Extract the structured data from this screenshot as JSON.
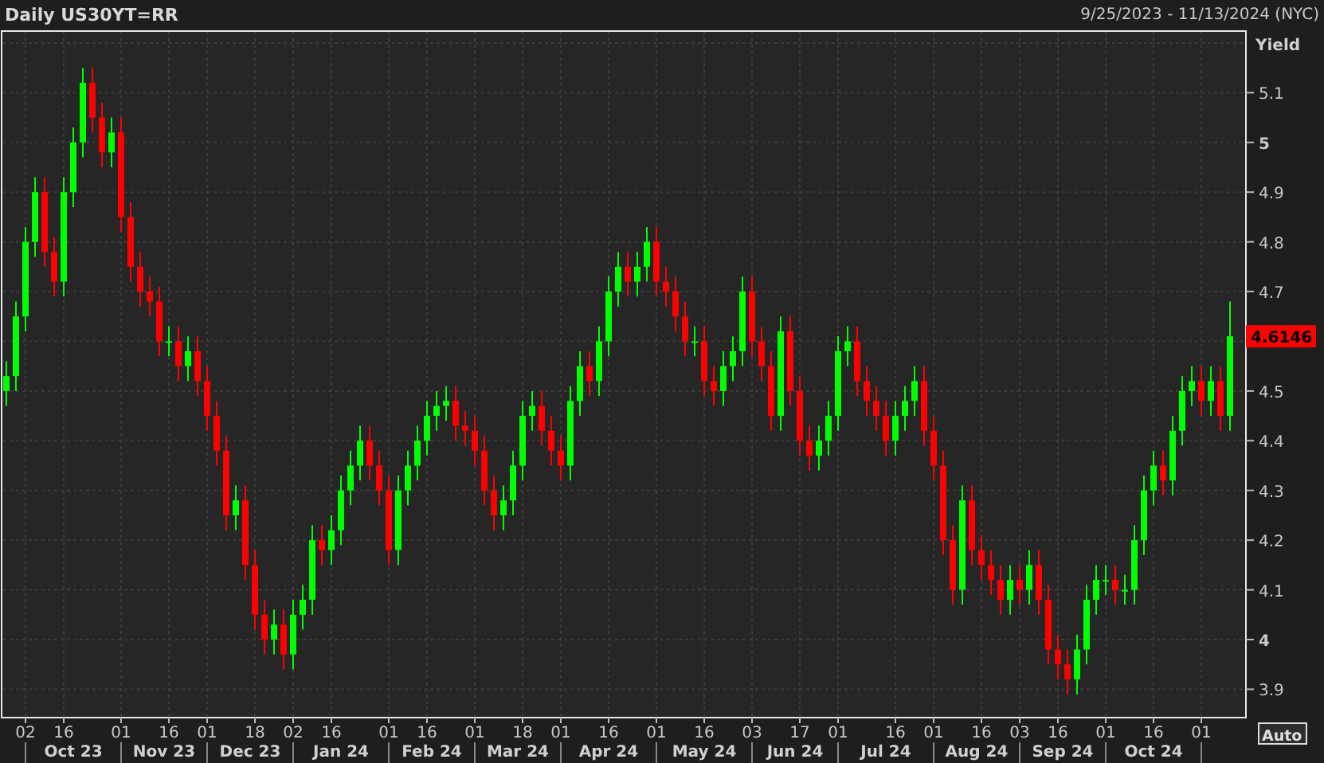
{
  "header": {
    "title": "Daily US30YT=RR",
    "range": "9/25/2023 - 11/13/2024 (NYC)"
  },
  "chart": {
    "chart_data": {
      "type": "candlestick",
      "ylabel": "Yield",
      "ylim": [
        3.843,
        5.224
      ],
      "grid": true,
      "yticks": [
        3.9,
        4,
        4.1,
        4.2,
        4.3,
        4.4,
        4.5,
        4.7,
        4.8,
        4.9,
        5,
        5.1
      ],
      "categories": [
        null,
        null,
        "02",
        null,
        null,
        null,
        "16",
        null,
        null,
        null,
        null,
        null,
        "01",
        null,
        null,
        null,
        null,
        "16",
        null,
        null,
        null,
        "01",
        null,
        null,
        null,
        null,
        "18",
        null,
        null,
        null,
        "02",
        null,
        null,
        null,
        "16",
        null,
        null,
        null,
        null,
        null,
        "01",
        null,
        null,
        null,
        "16",
        null,
        null,
        null,
        null,
        "01",
        null,
        null,
        null,
        null,
        "18",
        null,
        null,
        null,
        "01",
        null,
        null,
        null,
        null,
        "16",
        null,
        null,
        null,
        null,
        "01",
        null,
        null,
        null,
        null,
        "16",
        null,
        null,
        null,
        null,
        "03",
        null,
        null,
        null,
        null,
        "17",
        null,
        null,
        null,
        "01",
        null,
        null,
        null,
        null,
        null,
        "16",
        null,
        null,
        null,
        "01",
        null,
        null,
        null,
        null,
        "16",
        null,
        null,
        null,
        "03",
        null,
        null,
        null,
        "16",
        null,
        null,
        null,
        null,
        "01",
        null,
        null,
        null,
        null,
        "16",
        null,
        null,
        null,
        null,
        "01",
        null,
        null,
        null
      ],
      "ohlc": [
        [
          4.5,
          4.56,
          4.47,
          4.53
        ],
        [
          4.53,
          4.68,
          4.5,
          4.65
        ],
        [
          4.65,
          4.83,
          4.62,
          4.8
        ],
        [
          4.8,
          4.93,
          4.77,
          4.9
        ],
        [
          4.9,
          4.93,
          4.75,
          4.78
        ],
        [
          4.78,
          4.81,
          4.69,
          4.72
        ],
        [
          4.72,
          4.93,
          4.69,
          4.9
        ],
        [
          4.9,
          5.03,
          4.87,
          5.0
        ],
        [
          5.0,
          5.15,
          4.97,
          5.12
        ],
        [
          5.12,
          5.15,
          5.02,
          5.05
        ],
        [
          5.05,
          5.08,
          4.95,
          4.98
        ],
        [
          4.98,
          5.05,
          4.95,
          5.02
        ],
        [
          5.02,
          5.05,
          4.82,
          4.85
        ],
        [
          4.85,
          4.88,
          4.72,
          4.75
        ],
        [
          4.75,
          4.78,
          4.67,
          4.7
        ],
        [
          4.7,
          4.73,
          4.65,
          4.68
        ],
        [
          4.68,
          4.71,
          4.57,
          4.6
        ],
        [
          4.6,
          4.63,
          4.57,
          4.6
        ],
        [
          4.6,
          4.63,
          4.52,
          4.55
        ],
        [
          4.55,
          4.61,
          4.52,
          4.58
        ],
        [
          4.58,
          4.61,
          4.49,
          4.52
        ],
        [
          4.52,
          4.55,
          4.42,
          4.45
        ],
        [
          4.45,
          4.48,
          4.35,
          4.38
        ],
        [
          4.38,
          4.41,
          4.22,
          4.25
        ],
        [
          4.25,
          4.31,
          4.22,
          4.28
        ],
        [
          4.28,
          4.31,
          4.12,
          4.15
        ],
        [
          4.15,
          4.18,
          4.02,
          4.05
        ],
        [
          4.05,
          4.08,
          3.97,
          4.0
        ],
        [
          4.0,
          4.06,
          3.97,
          4.03
        ],
        [
          4.03,
          4.06,
          3.94,
          3.97
        ],
        [
          3.97,
          4.08,
          3.94,
          4.05
        ],
        [
          4.05,
          4.11,
          4.02,
          4.08
        ],
        [
          4.08,
          4.23,
          4.05,
          4.2
        ],
        [
          4.2,
          4.23,
          4.15,
          4.18
        ],
        [
          4.18,
          4.25,
          4.15,
          4.22
        ],
        [
          4.22,
          4.33,
          4.19,
          4.3
        ],
        [
          4.3,
          4.38,
          4.27,
          4.35
        ],
        [
          4.35,
          4.43,
          4.32,
          4.4
        ],
        [
          4.4,
          4.43,
          4.32,
          4.35
        ],
        [
          4.35,
          4.38,
          4.27,
          4.3
        ],
        [
          4.3,
          4.33,
          4.15,
          4.18
        ],
        [
          4.18,
          4.33,
          4.15,
          4.3
        ],
        [
          4.3,
          4.38,
          4.27,
          4.35
        ],
        [
          4.35,
          4.43,
          4.32,
          4.4
        ],
        [
          4.4,
          4.48,
          4.37,
          4.45
        ],
        [
          4.45,
          4.5,
          4.42,
          4.47
        ],
        [
          4.47,
          4.51,
          4.44,
          4.48
        ],
        [
          4.48,
          4.51,
          4.4,
          4.43
        ],
        [
          4.43,
          4.46,
          4.39,
          4.42
        ],
        [
          4.42,
          4.45,
          4.35,
          4.38
        ],
        [
          4.38,
          4.41,
          4.27,
          4.3
        ],
        [
          4.3,
          4.33,
          4.22,
          4.25
        ],
        [
          4.25,
          4.31,
          4.22,
          4.28
        ],
        [
          4.28,
          4.38,
          4.25,
          4.35
        ],
        [
          4.35,
          4.48,
          4.32,
          4.45
        ],
        [
          4.45,
          4.5,
          4.42,
          4.47
        ],
        [
          4.47,
          4.5,
          4.39,
          4.42
        ],
        [
          4.42,
          4.45,
          4.35,
          4.38
        ],
        [
          4.38,
          4.41,
          4.32,
          4.35
        ],
        [
          4.35,
          4.51,
          4.32,
          4.48
        ],
        [
          4.48,
          4.58,
          4.45,
          4.55
        ],
        [
          4.55,
          4.58,
          4.49,
          4.52
        ],
        [
          4.52,
          4.63,
          4.49,
          4.6
        ],
        [
          4.6,
          4.73,
          4.57,
          4.7
        ],
        [
          4.7,
          4.78,
          4.67,
          4.75
        ],
        [
          4.75,
          4.78,
          4.69,
          4.72
        ],
        [
          4.72,
          4.78,
          4.69,
          4.75
        ],
        [
          4.75,
          4.83,
          4.72,
          4.8
        ],
        [
          4.8,
          4.83,
          4.69,
          4.72
        ],
        [
          4.72,
          4.75,
          4.67,
          4.7
        ],
        [
          4.7,
          4.73,
          4.62,
          4.65
        ],
        [
          4.65,
          4.68,
          4.57,
          4.6
        ],
        [
          4.6,
          4.63,
          4.57,
          4.6
        ],
        [
          4.6,
          4.63,
          4.49,
          4.52
        ],
        [
          4.52,
          4.55,
          4.47,
          4.5
        ],
        [
          4.5,
          4.58,
          4.47,
          4.55
        ],
        [
          4.55,
          4.61,
          4.52,
          4.58
        ],
        [
          4.58,
          4.73,
          4.55,
          4.7
        ],
        [
          4.7,
          4.73,
          4.57,
          4.6
        ],
        [
          4.6,
          4.63,
          4.52,
          4.55
        ],
        [
          4.55,
          4.58,
          4.42,
          4.45
        ],
        [
          4.45,
          4.65,
          4.42,
          4.62
        ],
        [
          4.62,
          4.65,
          4.47,
          4.5
        ],
        [
          4.5,
          4.53,
          4.37,
          4.4
        ],
        [
          4.4,
          4.43,
          4.34,
          4.37
        ],
        [
          4.37,
          4.43,
          4.34,
          4.4
        ],
        [
          4.4,
          4.48,
          4.37,
          4.45
        ],
        [
          4.45,
          4.61,
          4.42,
          4.58
        ],
        [
          4.58,
          4.63,
          4.55,
          4.6
        ],
        [
          4.6,
          4.63,
          4.49,
          4.52
        ],
        [
          4.52,
          4.55,
          4.45,
          4.48
        ],
        [
          4.48,
          4.51,
          4.42,
          4.45
        ],
        [
          4.45,
          4.48,
          4.37,
          4.4
        ],
        [
          4.4,
          4.48,
          4.37,
          4.45
        ],
        [
          4.45,
          4.51,
          4.42,
          4.48
        ],
        [
          4.48,
          4.55,
          4.45,
          4.52
        ],
        [
          4.52,
          4.55,
          4.39,
          4.42
        ],
        [
          4.42,
          4.45,
          4.32,
          4.35
        ],
        [
          4.35,
          4.38,
          4.17,
          4.2
        ],
        [
          4.2,
          4.23,
          4.07,
          4.1
        ],
        [
          4.1,
          4.31,
          4.07,
          4.28
        ],
        [
          4.28,
          4.31,
          4.15,
          4.18
        ],
        [
          4.18,
          4.21,
          4.12,
          4.15
        ],
        [
          4.15,
          4.18,
          4.09,
          4.12
        ],
        [
          4.12,
          4.15,
          4.05,
          4.08
        ],
        [
          4.08,
          4.15,
          4.05,
          4.12
        ],
        [
          4.12,
          4.15,
          4.07,
          4.1
        ],
        [
          4.1,
          4.18,
          4.07,
          4.15
        ],
        [
          4.15,
          4.18,
          4.05,
          4.08
        ],
        [
          4.08,
          4.11,
          3.95,
          3.98
        ],
        [
          3.98,
          4.01,
          3.92,
          3.95
        ],
        [
          3.95,
          3.98,
          3.89,
          3.92
        ],
        [
          3.92,
          4.01,
          3.89,
          3.98
        ],
        [
          3.98,
          4.11,
          3.95,
          4.08
        ],
        [
          4.08,
          4.15,
          4.05,
          4.12
        ],
        [
          4.12,
          4.15,
          4.09,
          4.12
        ],
        [
          4.12,
          4.15,
          4.07,
          4.1
        ],
        [
          4.1,
          4.13,
          4.07,
          4.1
        ],
        [
          4.1,
          4.23,
          4.07,
          4.2
        ],
        [
          4.2,
          4.33,
          4.17,
          4.3
        ],
        [
          4.3,
          4.38,
          4.27,
          4.35
        ],
        [
          4.35,
          4.38,
          4.29,
          4.32
        ],
        [
          4.32,
          4.45,
          4.29,
          4.42
        ],
        [
          4.42,
          4.53,
          4.39,
          4.5
        ],
        [
          4.5,
          4.55,
          4.47,
          4.52
        ],
        [
          4.52,
          4.55,
          4.45,
          4.48
        ],
        [
          4.48,
          4.55,
          4.45,
          4.52
        ],
        [
          4.52,
          4.55,
          4.42,
          4.45
        ],
        [
          4.45,
          4.68,
          4.42,
          4.61
        ]
      ]
    },
    "months": [
      "Oct 23",
      "Nov 23",
      "Dec 23",
      "Jan 24",
      "Feb 24",
      "Mar 24",
      "Apr 24",
      "May 24",
      "Jun 24",
      "Jul 24",
      "Aug 24",
      "Sep 24",
      "Oct 24"
    ],
    "last_price": "4.6146",
    "scale_button": "Auto"
  }
}
